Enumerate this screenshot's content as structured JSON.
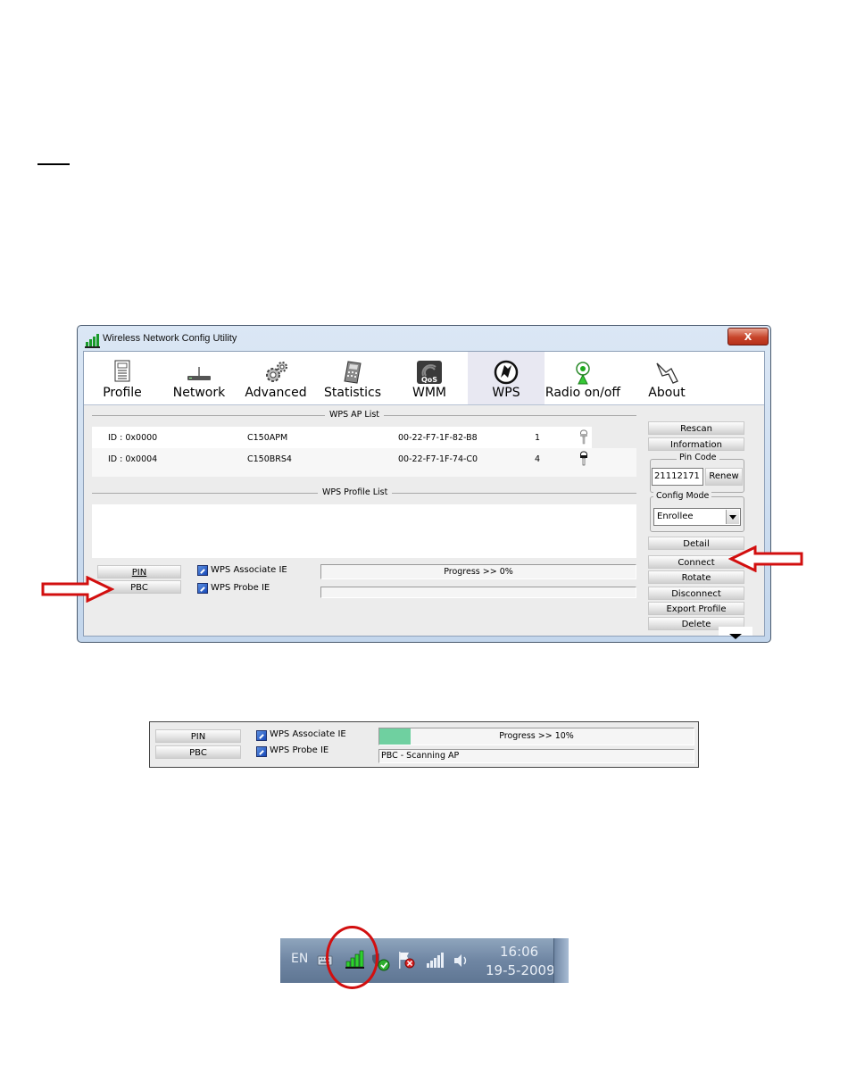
{
  "window": {
    "title": "Wireless Network Config Utility",
    "close_label": "X"
  },
  "toolbar": {
    "items": [
      {
        "label": "Profile",
        "icon": "profile-icon"
      },
      {
        "label": "Network",
        "icon": "network-icon"
      },
      {
        "label": "Advanced",
        "icon": "advanced-icon"
      },
      {
        "label": "Statistics",
        "icon": "statistics-icon"
      },
      {
        "label": "WMM",
        "icon": "wmm-icon",
        "icon_text": "QoS"
      },
      {
        "label": "WPS",
        "icon": "wps-icon",
        "active": true
      },
      {
        "label": "Radio on/off",
        "icon": "radio-icon"
      },
      {
        "label": "About",
        "icon": "about-icon"
      }
    ]
  },
  "wps_ap_list": {
    "title": "WPS AP List",
    "rows": [
      {
        "id": "ID : 0x0000",
        "ssid": "C150APM",
        "mac": "00-22-F7-1F-82-B8",
        "channel": "1",
        "lock": "unlocked"
      },
      {
        "id": "ID : 0x0004",
        "ssid": "C150BRS4",
        "mac": "00-22-F7-1F-74-C0",
        "channel": "4",
        "lock": "locked"
      }
    ]
  },
  "wps_profile_list": {
    "title": "WPS Profile List"
  },
  "bottom": {
    "pin_label": "PIN",
    "pbc_label": "PBC",
    "associate_label": "WPS Associate IE",
    "probe_label": "WPS Probe IE",
    "progress_text": "Progress >> 0%",
    "progress_value": 0,
    "status_text": ""
  },
  "right_panel": {
    "rescan": "Rescan",
    "information": "Information",
    "pin_code_title": "Pin Code",
    "pin_code_value": "21112171",
    "renew": "Renew",
    "config_mode_title": "Config Mode",
    "config_mode_value": "Enrollee",
    "detail": "Detail",
    "connect": "Connect",
    "rotate": "Rotate",
    "disconnect": "Disconnect",
    "export_profile": "Export Profile",
    "delete": "Delete"
  },
  "panel2": {
    "pin_label": "PIN",
    "pbc_label": "PBC",
    "associate_label": "WPS Associate IE",
    "probe_label": "WPS Probe IE",
    "progress_text": "Progress >> 10%",
    "progress_value": 10,
    "status_text": "PBC - Scanning AP"
  },
  "taskbar": {
    "language": "EN",
    "time": "16:06",
    "date": "19-5-2009"
  },
  "colors": {
    "highlight_red": "#d20f0f",
    "progress_fill": "#6fd0a0",
    "title_bar": "#c3d6ec"
  }
}
